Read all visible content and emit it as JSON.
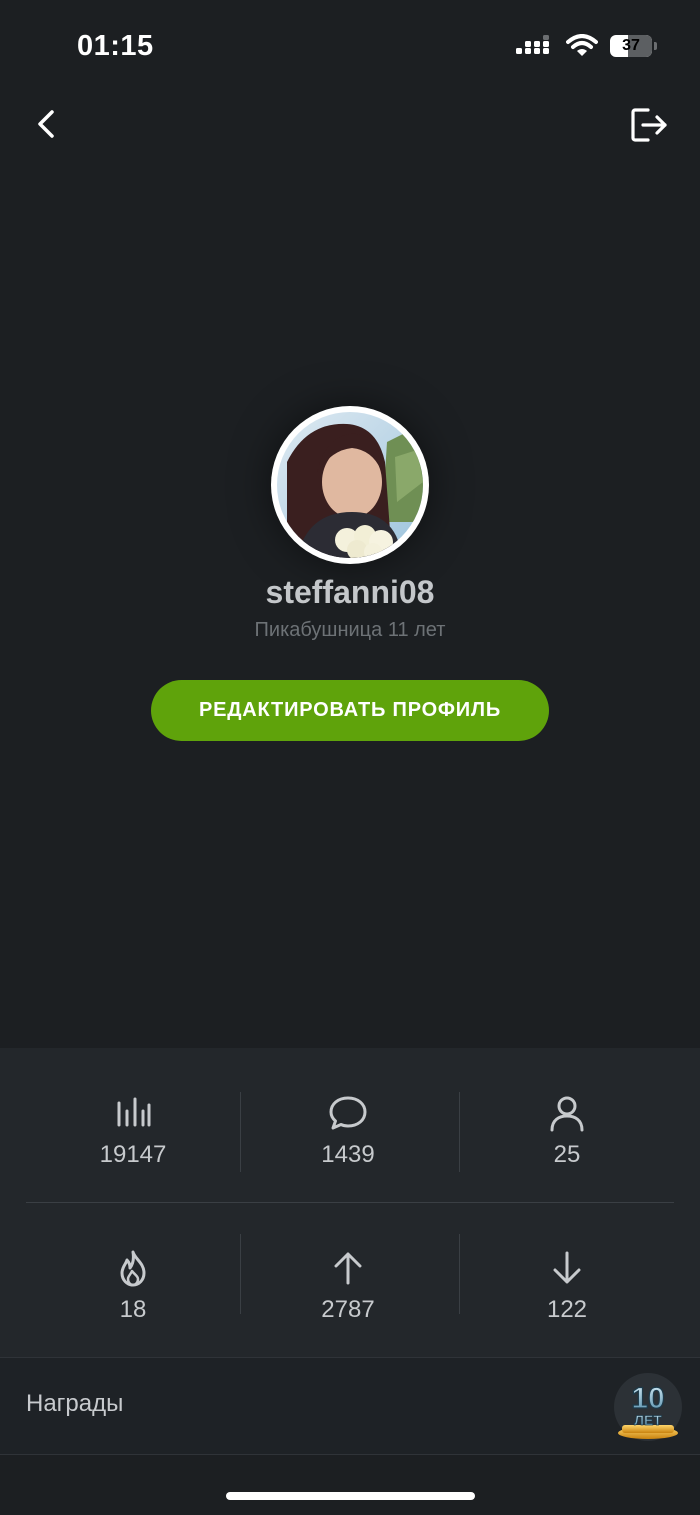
{
  "status_bar": {
    "time": "01:15",
    "battery": "37",
    "icons": [
      "signal-icon",
      "wifi-icon",
      "battery-icon"
    ]
  },
  "nav": {
    "icons": [
      "back-chevron-icon",
      "logout-icon"
    ]
  },
  "profile": {
    "username": "steffanni08",
    "subtitle": "Пикабушница 11 лет",
    "edit_button_label": "РЕДАКТИРОВАТЬ ПРОФИЛЬ"
  },
  "stats": [
    {
      "icon": "rating-bars-icon",
      "value": "19147"
    },
    {
      "icon": "comment-bubble-icon",
      "value": "1439"
    },
    {
      "icon": "user-icon",
      "value": "25"
    },
    {
      "icon": "fire-icon",
      "value": "18"
    },
    {
      "icon": "arrow-up-icon",
      "value": "2787"
    },
    {
      "icon": "arrow-down-icon",
      "value": "122"
    }
  ],
  "awards": {
    "label": "Награды",
    "badge_text": "10 ЛЕТ"
  },
  "colors": {
    "background": "#1c1f22",
    "panel": "#23272b",
    "accent_green": "#5fa30b",
    "text_light": "#c7cacd",
    "text_muted": "#6d7276"
  }
}
